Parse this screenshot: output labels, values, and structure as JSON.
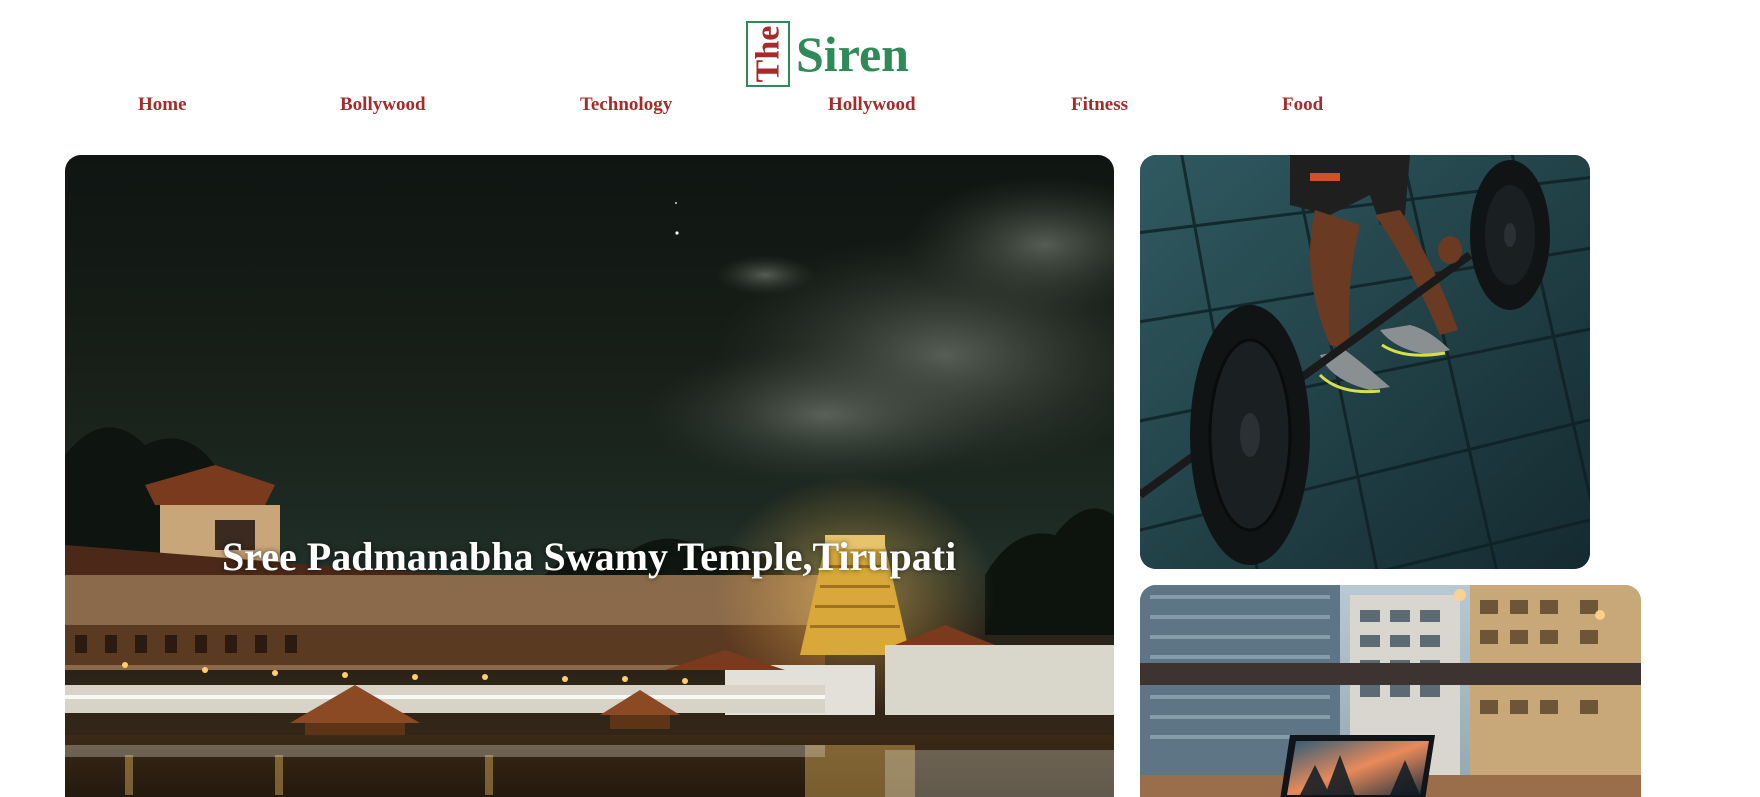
{
  "brand": {
    "prefix": "The",
    "name": "Siren",
    "colors": {
      "green": "#2e8b57",
      "red": "#a52a2a"
    }
  },
  "nav": {
    "items": [
      {
        "label": "Home"
      },
      {
        "label": "Bollywood"
      },
      {
        "label": "Technology"
      },
      {
        "label": "Hollywood"
      },
      {
        "label": "Fitness"
      },
      {
        "label": "Food"
      }
    ]
  },
  "featured": {
    "hero": {
      "title": "Sree Padmanabha Swamy Temple,Tirupati",
      "image": "night-temple-photo"
    },
    "side_top": {
      "image": "barbell-deadlift-photo"
    },
    "side_bottom": {
      "image": "laptop-window-photo"
    }
  }
}
